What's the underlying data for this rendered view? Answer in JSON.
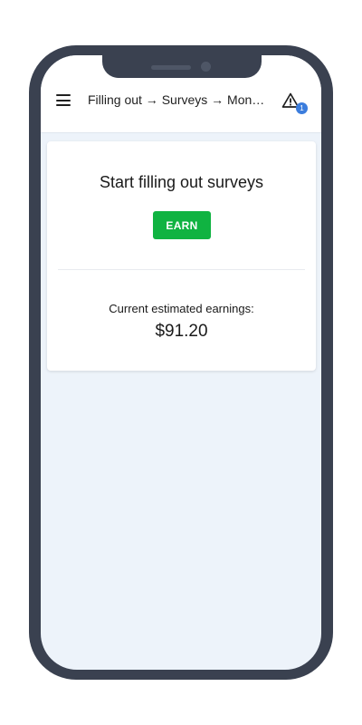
{
  "header": {
    "breadcrumb": "Filling out → Surveys → Moneti…",
    "alert_badge_count": "1",
    "menu_icon": "hamburger-menu-icon",
    "alert_icon": "warning-triangle-icon"
  },
  "card": {
    "title": "Start filling out surveys",
    "earn_label": "EARN",
    "earnings_label": "Current estimated earnings:",
    "earnings_value": "$91.20"
  },
  "colors": {
    "earn_button": "#10b341",
    "badge": "#3b7ddd",
    "phone_frame": "#3a4150",
    "screen_background": "#edf3fa"
  }
}
